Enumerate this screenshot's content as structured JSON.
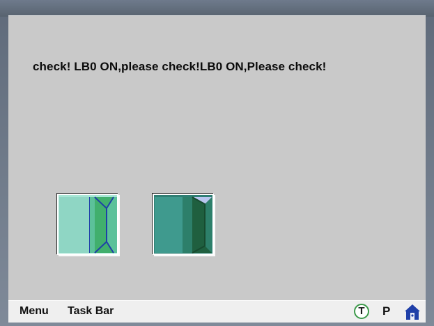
{
  "screen": {
    "marquee_text": "check! LB0 ON,please check!LB0 ON,Please check!"
  },
  "buttons": [
    {
      "name": "door-left",
      "icon": "door-open-icon",
      "state": "open"
    },
    {
      "name": "door-right",
      "icon": "door-closed-icon",
      "state": "closed"
    }
  ],
  "taskbar": {
    "menu_label": "Menu",
    "taskbar_label": "Task Bar",
    "t_label": "T",
    "p_label": "P",
    "lock_icon": "home-lock-icon"
  },
  "colors": {
    "screen_bg": "#c9c9c9",
    "taskbar_bg": "#efefef",
    "door_light": "#8fd6c4",
    "door_green": "#3fae6a",
    "door_dark": "#2f7f74",
    "accent_blue": "#1f3fa8"
  }
}
